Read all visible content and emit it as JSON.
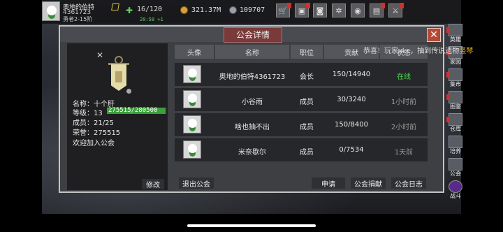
{
  "player": {
    "name": "奥地的伯特",
    "id": "4361723",
    "rank": "勇者2-15阶",
    "energy": "16/120",
    "energy_timer": "20:58 +1",
    "gold": "321.37M",
    "gems": "109707"
  },
  "top_buttons": [
    {
      "icon": "shop-icon",
      "glyph": "🛒"
    },
    {
      "icon": "chest-icon",
      "glyph": "▣"
    },
    {
      "icon": "gamepad-icon",
      "glyph": "◙"
    },
    {
      "icon": "gear-icon",
      "glyph": "✲"
    },
    {
      "icon": "wheel-icon",
      "glyph": "◉"
    },
    {
      "icon": "gift-icon",
      "glyph": "▤"
    },
    {
      "icon": "sword-icon",
      "glyph": "⚔"
    }
  ],
  "side_nav": [
    {
      "label": "英雄"
    },
    {
      "label": "家园"
    },
    {
      "label": "集市"
    },
    {
      "label": "图鉴"
    },
    {
      "label": "仓库"
    },
    {
      "label": "培养"
    },
    {
      "label": "公会"
    },
    {
      "label": "战斗"
    }
  ],
  "modal": {
    "title": "公会详情",
    "close": "✕"
  },
  "guild": {
    "name_label": "名称：十个肝",
    "level_label": "等级：13",
    "level_progress": "275515/280500",
    "level_fraction": 0.982,
    "members_label": "成员：21/25",
    "honor_label": "荣誉：275515",
    "welcome": "欢迎加入公会",
    "modify": "修改"
  },
  "table": {
    "headers": [
      "头像",
      "名称",
      "职位",
      "贡献",
      "状态"
    ],
    "rows": [
      {
        "name": "奥地的伯特4361723",
        "role": "会长",
        "contribution": "150/14940",
        "status": "在线",
        "online": true
      },
      {
        "name": "小谷雨",
        "role": "成员",
        "contribution": "30/3240",
        "status": "1小时前",
        "online": false
      },
      {
        "name": "啥也抽不出",
        "role": "成员",
        "contribution": "150/8400",
        "status": "2小时前",
        "online": false
      },
      {
        "name": "米奈歇尔",
        "role": "成员",
        "contribution": "0/7534",
        "status": "1天前",
        "online": false
      }
    ]
  },
  "notice": {
    "prefix": "恭喜！玩家xkc，抽到传说遗物",
    "highlight": "竖琴"
  },
  "buttons": {
    "leave": "退出公会",
    "apply": "申请",
    "donate": "公会捐献",
    "log": "公会日志"
  },
  "colors": {
    "online": "#4fd34f",
    "offline": "#9a9a9a",
    "accent_red": "#b34a35"
  }
}
